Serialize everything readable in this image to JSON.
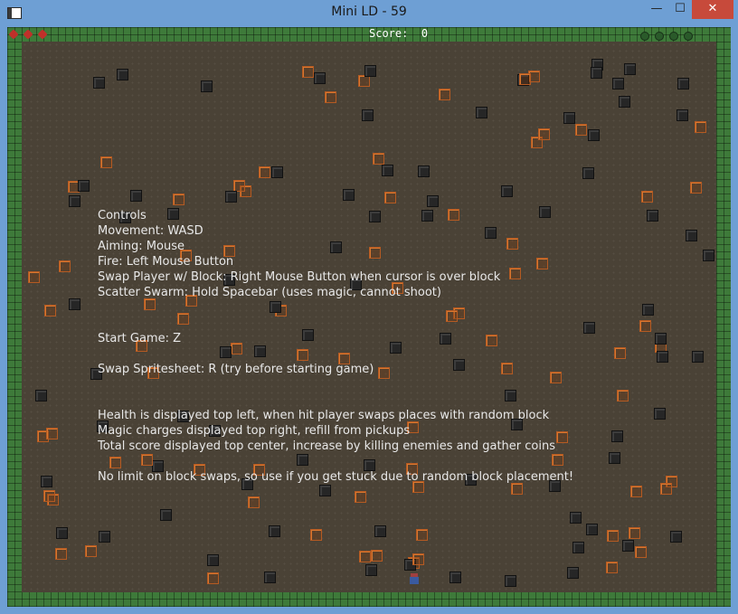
{
  "window": {
    "title": "Mini LD - 59",
    "minimize": "—",
    "maximize": "☐",
    "close": "✕"
  },
  "hud": {
    "score_label": "Score:",
    "score_value": "0",
    "health": 3,
    "magic": 4
  },
  "instructions": {
    "lines": [
      "Controls",
      "Movement: WASD",
      "Aiming: Mouse",
      "Fire: Left Mouse Button",
      "Swap Player w/ Block: Right Mouse Button when cursor is over block",
      "Scatter Swarm: Hold Spacebar (uses magic, cannot shoot)",
      "",
      "",
      "Start Game: Z",
      "",
      "Swap Spritesheet: R (try before starting game)",
      "",
      "",
      "Health is displayed top left, when hit player swaps places with random block",
      "Magic charges displayed top right, refill from pickups",
      "Total score displayed top center, increase by killing enemies and gather coins",
      "",
      "No limit on block swaps, so use if you get stuck due to random block placement!"
    ]
  },
  "colors": {
    "border": "#3e7a3a",
    "floor": "#4a4236",
    "dark_block": "#262626",
    "orange_block": "#b45a22",
    "text": "#e8e8e8"
  }
}
